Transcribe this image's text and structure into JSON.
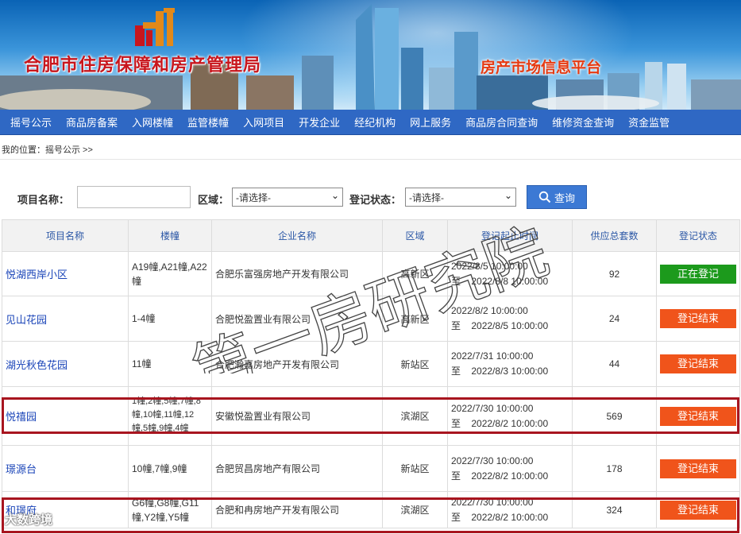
{
  "banner": {
    "title": "合肥市住房保障和房产管理局",
    "subtitle": "房产市场信息平台"
  },
  "nav": {
    "items": [
      "摇号公示",
      "商品房备案",
      "入网楼幢",
      "监管楼幢",
      "入网项目",
      "开发企业",
      "经纪机构",
      "网上服务",
      "商品房合同查询",
      "维修资金查询",
      "资金监管"
    ]
  },
  "breadcrumb": "我的位置：摇号公示 >>",
  "search": {
    "project_label": "项目名称：",
    "project_value": "",
    "district_label": "区域：",
    "district_value": "-请选择-",
    "status_label": "登记状态：",
    "status_value": "-请选择-",
    "query_label": "查询"
  },
  "table": {
    "headers": [
      "项目名称",
      "楼幢",
      "企业名称",
      "区域",
      "登记起止时间",
      "供应总套数",
      "登记状态"
    ],
    "rows": [
      {
        "name": "悦湖西岸小区",
        "buildings": "A19幢,A21幢,A22幢",
        "company": "合肥乐富强房地产开发有限公司",
        "district": "高新区",
        "start": "2022/8/5 10:00:00",
        "end_prefix": "至",
        "end": "2022/8/8 10:00:00",
        "total": "92",
        "status": "正在登记",
        "status_color": "#1c9a1c"
      },
      {
        "name": "见山花园",
        "buildings": "1-4幢",
        "company": "合肥悦盈置业有限公司",
        "district": "高新区",
        "start": "2022/8/2 10:00:00",
        "end_prefix": "至",
        "end": "2022/8/5 10:00:00",
        "total": "24",
        "status": "登记结束",
        "status_color": "#f0541b"
      },
      {
        "name": "湖光秋色花园",
        "buildings": "11幢",
        "company": "合肥瀚嘉房地产开发有限公司",
        "district": "新站区",
        "start": "2022/7/31 10:00:00",
        "end_prefix": "至",
        "end": "2022/8/3 10:00:00",
        "total": "44",
        "status": "登记结束",
        "status_color": "#f0541b"
      },
      {
        "name": "悦禧园",
        "buildings": "1幢,2幢,5幢,7幢,8幢,10幢,11幢,12幢,5幢,9幢,4幢",
        "company": "安徽悦盈置业有限公司",
        "district": "滨湖区",
        "start": "2022/7/30 10:00:00",
        "end_prefix": "至",
        "end": "2022/8/2 10:00:00",
        "total": "569",
        "status": "登记结束",
        "status_color": "#f0541b"
      },
      {
        "name": "璟源台",
        "buildings": "10幢,7幢,9幢",
        "company": "合肥贸昌房地产有限公司",
        "district": "新站区",
        "start": "2022/7/30 10:00:00",
        "end_prefix": "至",
        "end": "2022/8/2 10:00:00",
        "total": "178",
        "status": "登记结束",
        "status_color": "#f0541b"
      },
      {
        "name": "和璟府",
        "buildings": "G6幢,G8幢,G11幢,Y2幢,Y5幢",
        "company": "合肥和冉房地产开发有限公司",
        "district": "滨湖区",
        "start": "2022/7/30 10:00:00",
        "end_prefix": "至",
        "end": "2022/8/2 10:00:00",
        "total": "324",
        "status": "登记结束",
        "status_color": "#f0541b"
      }
    ]
  },
  "watermark": "第一房研究院",
  "corner_watermark": "大数跨境",
  "colors": {
    "nav_bg": "#2f68c4",
    "highlight_border": "#a8151f",
    "status_active": "#1c9a1c",
    "status_ended": "#f0541b"
  }
}
